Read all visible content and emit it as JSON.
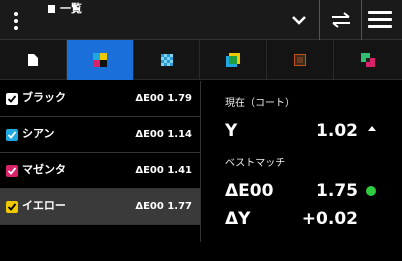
{
  "topbar": {
    "title": "一覧"
  },
  "list": {
    "rows": [
      {
        "label": "ブラック",
        "value": "ΔE00 1.79",
        "check_color": "#ffffff"
      },
      {
        "label": "シアン",
        "value": "ΔE00 1.14",
        "check_color": "#1fa8e0"
      },
      {
        "label": "マゼンタ",
        "value": "ΔE00 1.41",
        "check_color": "#d8236a"
      },
      {
        "label": "イエロー",
        "value": "ΔE00 1.77",
        "check_color": "#f0c800"
      }
    ],
    "selected_index": 3
  },
  "detail": {
    "current_label": "現在（コート）",
    "current_channel": "Y",
    "current_value": "1.02",
    "best_match_label": "ベストマッチ",
    "delta_e_label": "ΔE00",
    "delta_e_value": "1.75",
    "delta_y_label": "ΔY",
    "delta_y_value": "+0.02"
  },
  "colors": {
    "accent": "#1a6fd8",
    "status_good": "#2ecc40"
  }
}
